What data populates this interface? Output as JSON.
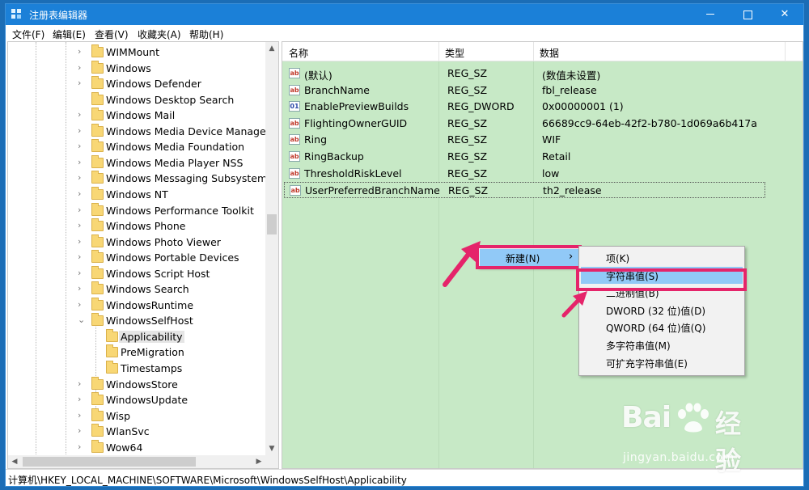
{
  "window": {
    "title": "注册表编辑器"
  },
  "menu": [
    "文件(F)",
    "编辑(E)",
    "查看(V)",
    "收藏夹(A)",
    "帮助(H)"
  ],
  "tree": {
    "items": [
      {
        "label": "WIMMount",
        "expandable": true
      },
      {
        "label": "Windows",
        "expandable": true
      },
      {
        "label": "Windows Defender",
        "expandable": true
      },
      {
        "label": "Windows Desktop Search",
        "expandable": false
      },
      {
        "label": "Windows Mail",
        "expandable": true
      },
      {
        "label": "Windows Media Device Manager",
        "expandable": true
      },
      {
        "label": "Windows Media Foundation",
        "expandable": true
      },
      {
        "label": "Windows Media Player NSS",
        "expandable": true
      },
      {
        "label": "Windows Messaging Subsystem",
        "expandable": true
      },
      {
        "label": "Windows NT",
        "expandable": true
      },
      {
        "label": "Windows Performance Toolkit",
        "expandable": true
      },
      {
        "label": "Windows Phone",
        "expandable": true
      },
      {
        "label": "Windows Photo Viewer",
        "expandable": true
      },
      {
        "label": "Windows Portable Devices",
        "expandable": true
      },
      {
        "label": "Windows Script Host",
        "expandable": true
      },
      {
        "label": "Windows Search",
        "expandable": true
      },
      {
        "label": "WindowsRuntime",
        "expandable": true
      },
      {
        "label": "WindowsSelfHost",
        "expandable": true,
        "expanded": true
      },
      {
        "label": "Applicability",
        "child": true,
        "selected": true
      },
      {
        "label": "PreMigration",
        "child": true
      },
      {
        "label": "Timestamps",
        "child": true
      },
      {
        "label": "WindowsStore",
        "expandable": true
      },
      {
        "label": "WindowsUpdate",
        "expandable": true
      },
      {
        "label": "Wisp",
        "expandable": true
      },
      {
        "label": "WlanSvc",
        "expandable": true
      },
      {
        "label": "Wow64",
        "expandable": true
      }
    ]
  },
  "list": {
    "columns": [
      "名称",
      "类型",
      "数据"
    ],
    "rows": [
      {
        "icon": "string-value-icon",
        "name": "(默认)",
        "type": "REG_SZ",
        "data": "(数值未设置)"
      },
      {
        "icon": "string-value-icon",
        "name": "BranchName",
        "type": "REG_SZ",
        "data": "fbl_release"
      },
      {
        "icon": "binary-value-icon",
        "name": "EnablePreviewBuilds",
        "type": "REG_DWORD",
        "data": "0x00000001 (1)"
      },
      {
        "icon": "string-value-icon",
        "name": "FlightingOwnerGUID",
        "type": "REG_SZ",
        "data": "66689cc9-64eb-42f2-b780-1d069a6b417a"
      },
      {
        "icon": "string-value-icon",
        "name": "Ring",
        "type": "REG_SZ",
        "data": "WIF"
      },
      {
        "icon": "string-value-icon",
        "name": "RingBackup",
        "type": "REG_SZ",
        "data": "Retail"
      },
      {
        "icon": "string-value-icon",
        "name": "ThresholdRiskLevel",
        "type": "REG_SZ",
        "data": "low"
      },
      {
        "icon": "string-value-icon",
        "name": "UserPreferredBranchName",
        "type": "REG_SZ",
        "data": "th2_release",
        "selected": true
      }
    ]
  },
  "context_menu": {
    "new_label": "新建(N)",
    "arrow": "›",
    "submenu": [
      "项(K)",
      "字符串值(S)",
      "二进制值(B)",
      "DWORD (32 位)值(D)",
      "QWORD (64 位)值(Q)",
      "多字符串值(M)",
      "可扩充字符串值(E)"
    ],
    "highlighted_index": 1
  },
  "status": {
    "path": "计算机\\HKEY_LOCAL_MACHINE\\SOFTWARE\\Microsoft\\WindowsSelfHost\\Applicability"
  },
  "watermark": {
    "brand_left": "Bai",
    "brand_right": "经验",
    "url": "jingyan.baidu.com"
  },
  "colors": {
    "accent": "#1b80d8",
    "highlight": "#e5246a",
    "list_bg": "#c7e9c6",
    "menu_hover": "#91c9f7"
  }
}
